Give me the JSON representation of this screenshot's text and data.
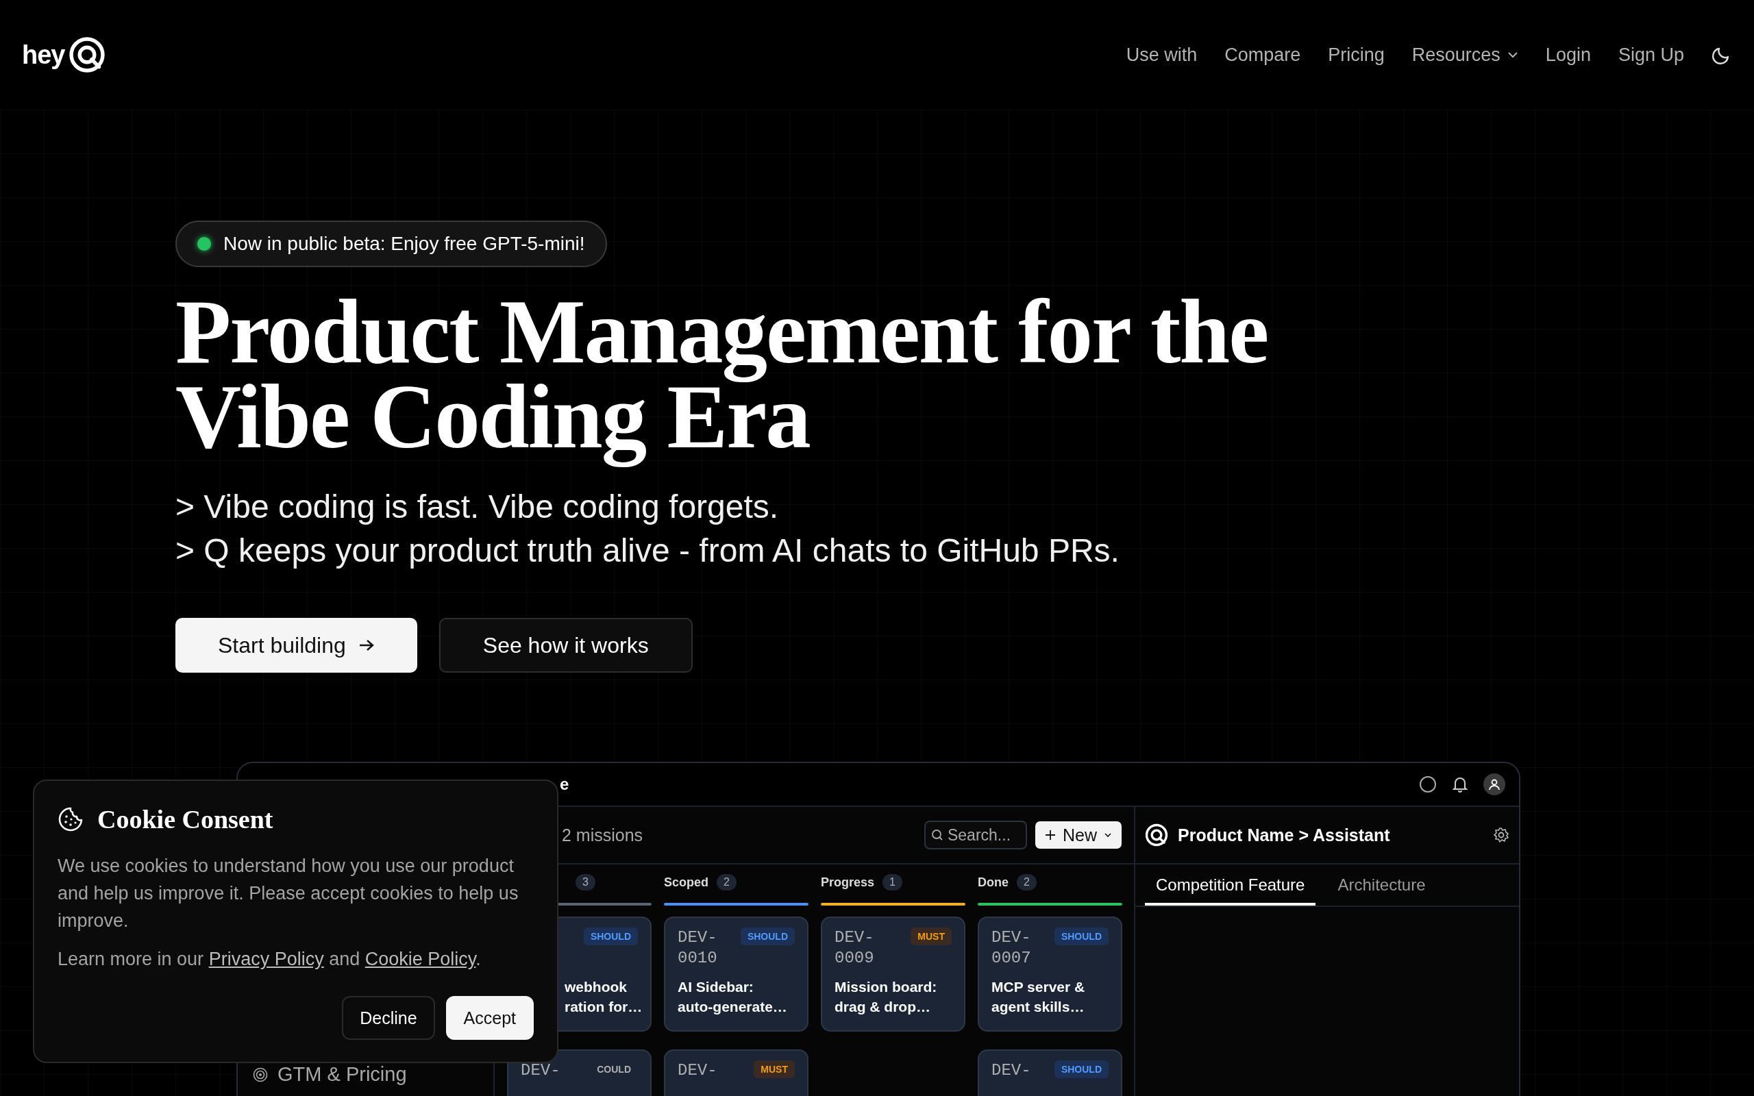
{
  "nav": {
    "logo": "hey",
    "links": [
      {
        "label": "Use with",
        "kind": "link"
      },
      {
        "label": "Compare",
        "kind": "link"
      },
      {
        "label": "Pricing",
        "kind": "link"
      },
      {
        "label": "Resources",
        "kind": "menu"
      },
      {
        "label": "Login",
        "kind": "link"
      },
      {
        "label": "Sign Up",
        "kind": "link"
      }
    ]
  },
  "hero": {
    "badge": "Now in public beta: Enjoy free GPT-5-mini!",
    "title": "Product Management for the Vibe Coding Era",
    "subtitle": [
      "> Vibe coding is fast. Vibe coding forgets.",
      "> Q keeps your product truth alive - from AI chats to GitHub PRs."
    ],
    "buttons": [
      {
        "label": "Start building",
        "kind": "primary"
      },
      {
        "label": "See how it works",
        "kind": "secondary"
      }
    ]
  },
  "app_preview": {
    "title_fragment": "e",
    "sidebar": {
      "items": [
        {
          "label": "GTM & Pricing"
        }
      ]
    },
    "missions_count": "2 missions",
    "search": {
      "placeholder": "Search..."
    },
    "new_button": "New",
    "columns": [
      {
        "count": "3",
        "color": "#5b6473",
        "cards": [
          {
            "kind": "partial",
            "priority": "SHOULD",
            "lines": [
              "webhook",
              "ration for…"
            ]
          },
          {
            "kind": "full",
            "id": "DEV-",
            "priority": "COULD"
          }
        ]
      },
      {
        "label": "Scoped",
        "count": "2",
        "color": "#4b8ef5",
        "cards": [
          {
            "kind": "full",
            "id": "DEV-0010",
            "priority": "SHOULD",
            "lines": [
              "AI Sidebar:",
              "auto-generate…"
            ]
          },
          {
            "kind": "full",
            "id": "DEV-",
            "priority": "MUST"
          }
        ]
      },
      {
        "label": "Progress",
        "count": "1",
        "color": "#f5b014",
        "cards": [
          {
            "kind": "full",
            "id": "DEV-0009",
            "priority": "MUST",
            "lines": [
              "Mission board:",
              "drag & drop…"
            ]
          }
        ]
      },
      {
        "label": "Done",
        "count": "2",
        "color": "#22c55e",
        "cards": [
          {
            "kind": "full",
            "id": "DEV-0007",
            "priority": "SHOULD",
            "lines": [
              "MCP server &",
              "agent skills…"
            ]
          },
          {
            "kind": "full",
            "id": "DEV-",
            "priority": "SHOULD"
          }
        ]
      }
    ],
    "assistant": {
      "title": "Product Name > Assistant",
      "tabs": [
        {
          "label": "Competition Feature",
          "selected": true
        },
        {
          "label": "Architecture",
          "selected": false
        }
      ]
    }
  },
  "cookie_dialog": {
    "title": "Cookie Consent",
    "body": "We use cookies to understand how you use our product and help us improve it. Please accept cookies to help us improve.",
    "learn_prefix": "Learn more in our",
    "privacy_link": "Privacy Policy",
    "and": "and",
    "cookie_link": "Cookie Policy",
    "period": ".",
    "buttons": [
      {
        "label": "Decline",
        "kind": "secondary"
      },
      {
        "label": "Accept",
        "kind": "primary"
      }
    ]
  }
}
